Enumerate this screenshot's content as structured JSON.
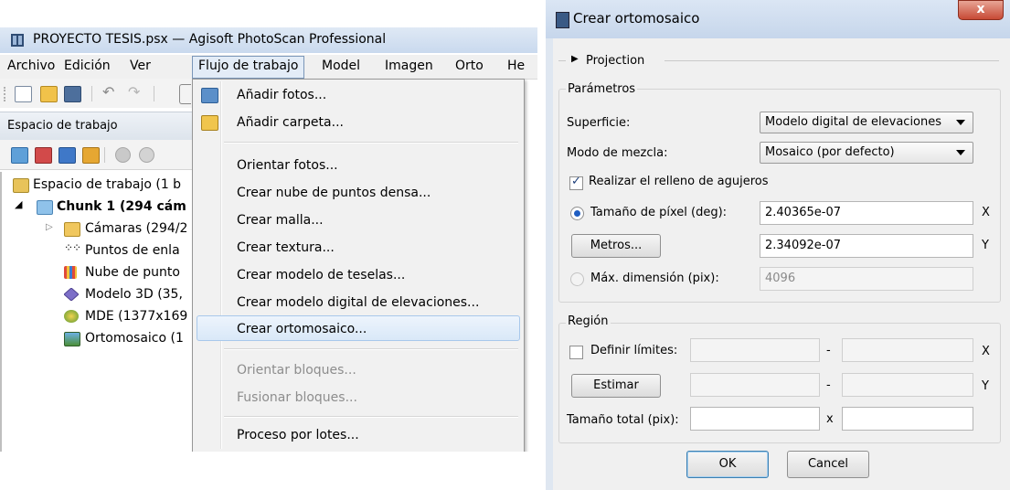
{
  "main_window": {
    "title": "PROYECTO TESIS.psx — Agisoft PhotoScan Professional",
    "menubar": [
      "Archivo",
      "Edición",
      "Ver",
      "Flujo de trabajo",
      "Model",
      "Imagen",
      "Orto",
      "He"
    ],
    "workspace_panel": {
      "title": "Espacio de trabajo",
      "tree": [
        {
          "label": "Espacio de trabajo (1 b",
          "icon": "workspace-icon"
        },
        {
          "label": "Chunk 1 (294 cám",
          "icon": "chunk-icon",
          "bold": true
        },
        {
          "label": "Cámaras (294/2",
          "icon": "folder-icon"
        },
        {
          "label": "Puntos de enla",
          "icon": "tie-points-icon"
        },
        {
          "label": "Nube de punto",
          "icon": "dense-cloud-icon"
        },
        {
          "label": "Modelo 3D (35,",
          "icon": "model-icon"
        },
        {
          "label": "MDE (1377x169",
          "icon": "dem-icon"
        },
        {
          "label": "Ortomosaico (1",
          "icon": "orthomosaic-icon"
        }
      ]
    },
    "workflow_menu": {
      "items": [
        {
          "label": "Añadir fotos...",
          "enabled": true
        },
        {
          "label": "Añadir carpeta...",
          "enabled": true
        },
        {
          "label": "Orientar fotos...",
          "enabled": true
        },
        {
          "label": "Crear nube de puntos densa...",
          "enabled": true
        },
        {
          "label": "Crear malla...",
          "enabled": true
        },
        {
          "label": "Crear textura...",
          "enabled": true
        },
        {
          "label": "Crear modelo de teselas...",
          "enabled": true
        },
        {
          "label": "Crear modelo digital de elevaciones...",
          "enabled": true
        },
        {
          "label": "Crear ortomosaico...",
          "enabled": true,
          "highlighted": true
        },
        {
          "label": "Orientar bloques...",
          "enabled": false
        },
        {
          "label": "Fusionar bloques...",
          "enabled": false
        },
        {
          "label": "Proceso por lotes...",
          "enabled": true
        }
      ]
    }
  },
  "dialog": {
    "title": "Crear ortomosaico",
    "close": "x",
    "projection_label": "Projection",
    "parameters": {
      "group_title": "Parámetros",
      "surface_label": "Superficie:",
      "surface_value": "Modelo digital de elevaciones",
      "blending_label": "Modo de mezcla:",
      "blending_value": "Mosaico (por defecto)",
      "hole_filling_label": "Realizar el relleno de agujeros",
      "hole_filling_checked": true,
      "pixel_size_label": "Tamaño de píxel (deg):",
      "pixel_size_x": "2.40365e-07",
      "metres_button": "Metros...",
      "pixel_size_y": "2.34092e-07",
      "max_dim_label": "Máx. dimensión (pix):",
      "max_dim_value": "4096",
      "x_label": "X",
      "y_label": "Y"
    },
    "region": {
      "group_title": "Región",
      "define_bounds_label": "Definir límites:",
      "estimate_button": "Estimar",
      "total_size_label": "Tamaño total (pix):",
      "dash": "-",
      "times": "x",
      "x_label": "X",
      "y_label": "Y"
    },
    "ok_button": "OK",
    "cancel_button": "Cancel"
  }
}
